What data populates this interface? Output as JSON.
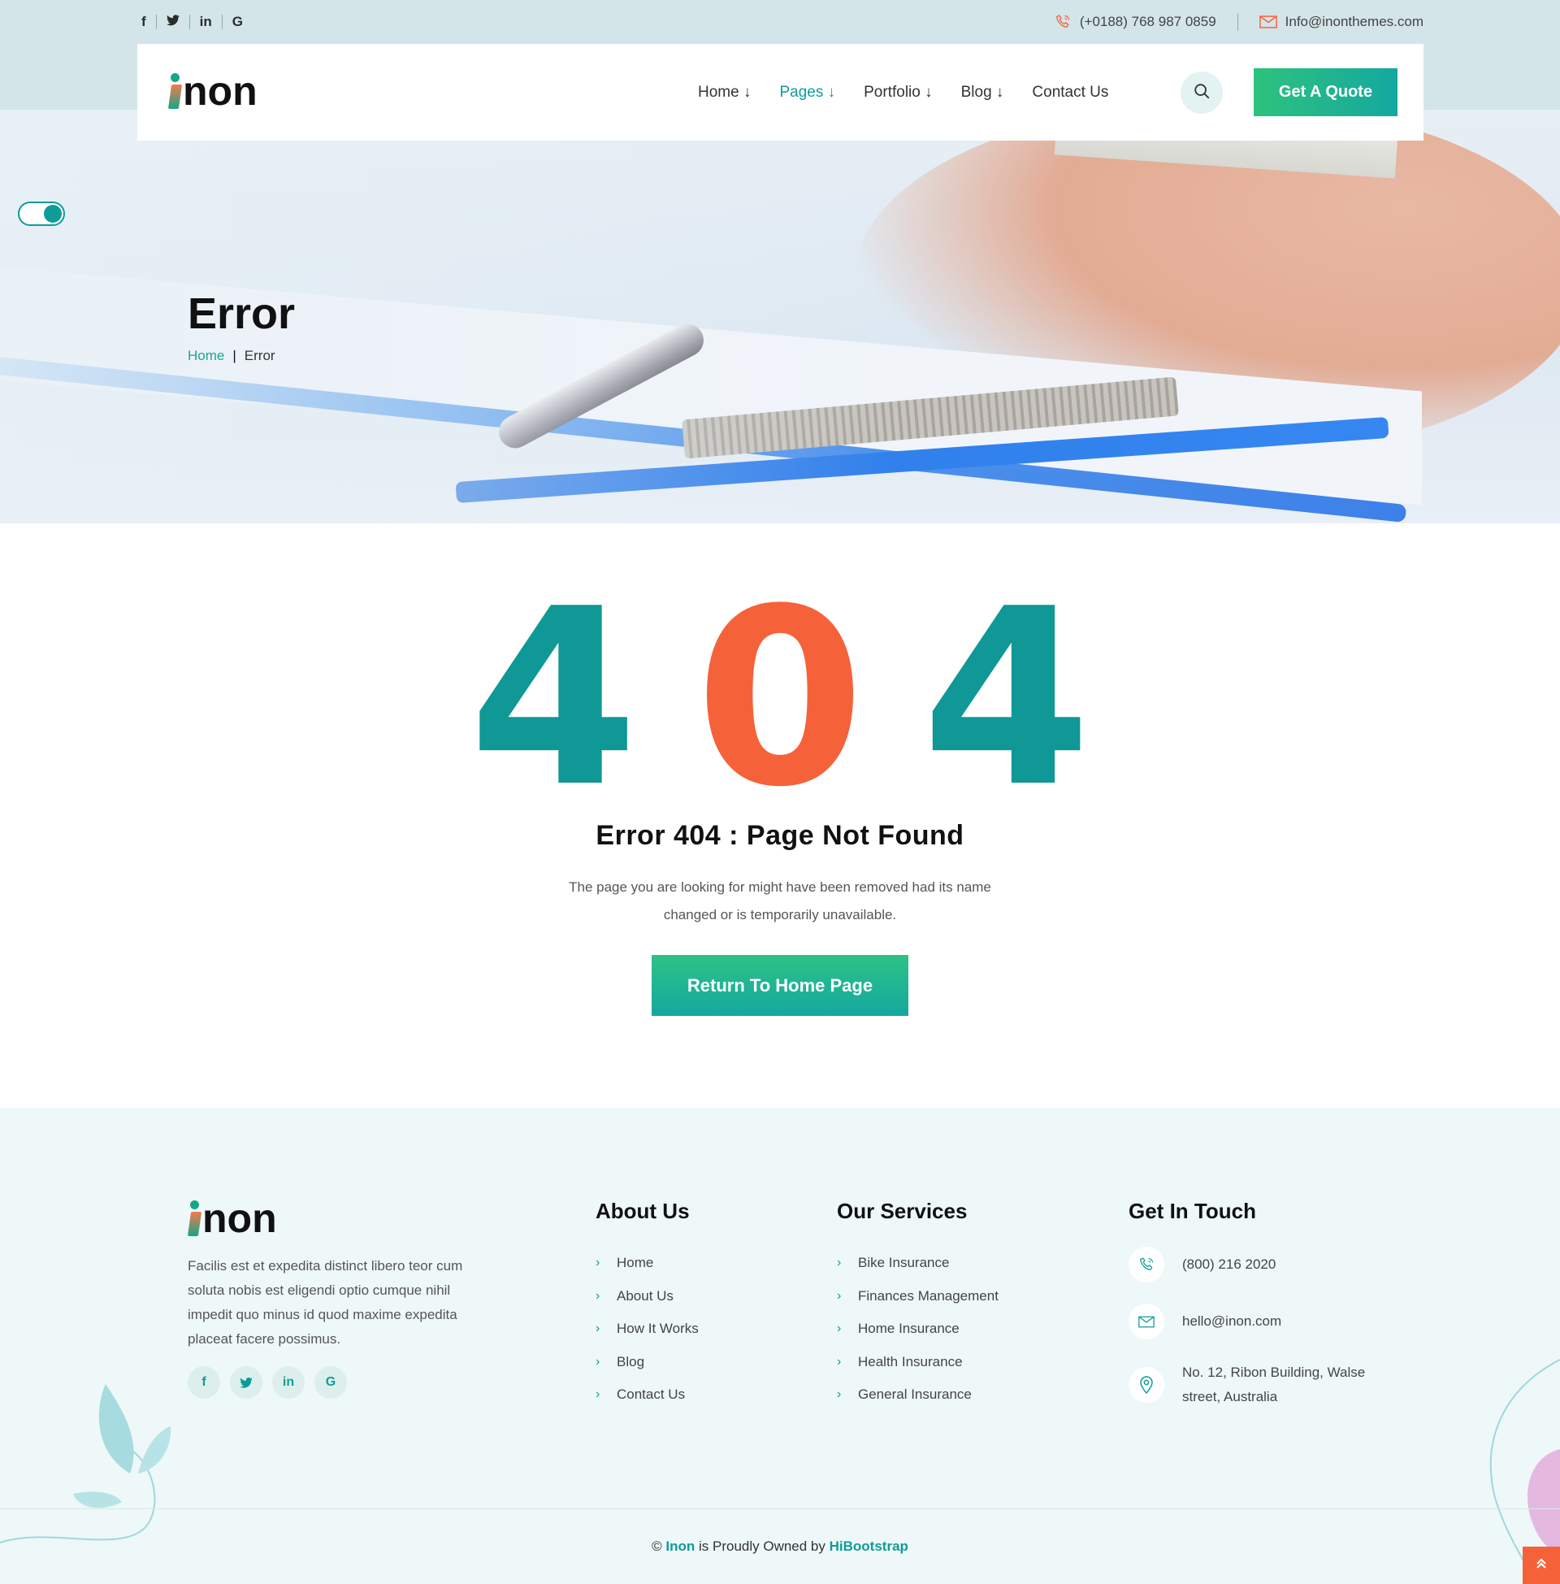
{
  "topbar": {
    "socials": [
      "f",
      "🐦",
      "in",
      "G"
    ],
    "phone": "(+0188) 768 987 0859",
    "email": "Info@inonthemes.com"
  },
  "brand": {
    "logo_text": "non"
  },
  "nav": {
    "items": [
      {
        "label": "Home ↓",
        "active": false
      },
      {
        "label": "Pages ↓",
        "active": true
      },
      {
        "label": "Portfolio ↓",
        "active": false
      },
      {
        "label": "Blog ↓",
        "active": false
      },
      {
        "label": "Contact Us",
        "active": false
      }
    ],
    "quote_label": "Get A Quote"
  },
  "hero": {
    "title": "Error",
    "breadcrumb": {
      "home": "Home",
      "sep": "|",
      "current": "Error"
    }
  },
  "error": {
    "digits": [
      "4",
      "0",
      "4"
    ],
    "title": "Error 404 : Page Not Found",
    "description": "The page you are looking for might have been removed had its name changed or is temporarily unavailable.",
    "button_label": "Return To Home Page"
  },
  "footer": {
    "logo_text": "non",
    "about_text": "Facilis est et expedita distinct libero teor cum soluta nobis est eligendi optio cumque nihil impedit quo minus id quod maxime expedita placeat facere possimus.",
    "socials": [
      "f",
      "🐦",
      "in",
      "G"
    ],
    "about_us": {
      "title": "About Us",
      "links": [
        "Home",
        "About Us",
        "How It Works",
        "Blog",
        "Contact Us"
      ]
    },
    "services": {
      "title": "Our Services",
      "links": [
        "Bike Insurance",
        "Finances Management",
        "Home Insurance",
        "Health Insurance",
        "General Insurance"
      ]
    },
    "touch": {
      "title": "Get In Touch",
      "phone": "(800) 216 2020",
      "email": "hello@inon.com",
      "address": "No. 12, Ribon Building, Walse street, Australia"
    },
    "copyright": {
      "prefix": "©",
      "brand": "Inon",
      "middle": "is Proudly Owned by",
      "owner": "HiBootstrap"
    }
  },
  "colors": {
    "teal": "#0f9895",
    "orange": "#f5623a",
    "green": "#2ec27e"
  },
  "icons": {
    "phone": "phone-icon",
    "email": "envelope-icon",
    "location": "location-pin-icon",
    "search": "search-icon",
    "scroll_top": "double-chevron-up-icon"
  }
}
